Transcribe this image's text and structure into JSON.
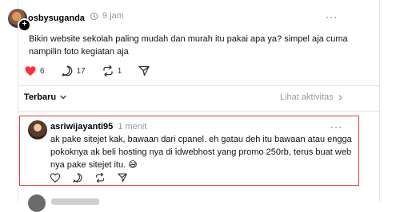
{
  "post": {
    "username": "osbysuganda",
    "time": "9 jam",
    "more": "···",
    "text_line1": "Bikin website sekolah paling mudah dan murah itu pakai apa ya? simpel aja cuma",
    "text_line2": "nampilin foto kegiatan aja",
    "likes": "6",
    "comments": "17",
    "reposts": "1"
  },
  "replies_header": {
    "sort_label": "Terbaru",
    "activity_link": "Lihat aktivitas"
  },
  "reply": {
    "username": "asriwijayanti95",
    "time": "1 menit",
    "more": "···",
    "text_line1": "ak pake sitejet kak, bawaan dari cpanel. eh gatau deh itu bawaan atau engga",
    "text_line2": "pokoknya ak beli hosting nya di idwebhost yang promo 250rb, terus buat web",
    "text_line3": "nya pake sitejet itu. 😅"
  },
  "colors": {
    "like_red": "#ff3040",
    "highlight_border": "#e03b3b",
    "muted": "#999999"
  }
}
